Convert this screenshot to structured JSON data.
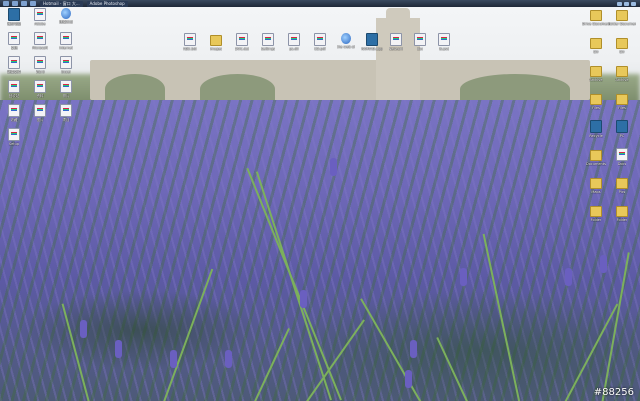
{
  "taskbar": {
    "tasks": [
      {
        "label": "Hotmail - 窗口 大..."
      },
      {
        "label": "Adobe Photoshop"
      }
    ]
  },
  "desktop": {
    "icons_left": [
      {
        "label": "我的电脑",
        "kind": "app"
      },
      {
        "label": "Adobe",
        "kind": "file"
      },
      {
        "label": "快捷方式",
        "kind": "web"
      },
      {
        "label": "文档",
        "kind": "file"
      },
      {
        "label": "Microsoft",
        "kind": "file"
      },
      {
        "label": "Internet",
        "kind": "file"
      },
      {
        "label": "新建文件",
        "kind": "file"
      },
      {
        "label": "Word",
        "kind": "file"
      },
      {
        "label": "Excel",
        "kind": "file"
      },
      {
        "label": "回收站",
        "kind": "file"
      },
      {
        "label": "资料",
        "kind": "file"
      },
      {
        "label": "照片",
        "kind": "file"
      },
      {
        "label": "收藏",
        "kind": "file"
      },
      {
        "label": "图片",
        "kind": "file"
      },
      {
        "label": "项目",
        "kind": "file"
      },
      {
        "label": "Setup",
        "kind": "file"
      }
    ],
    "icons_top": [
      {
        "label": "ADE.bdr",
        "kind": "file"
      },
      {
        "label": "Images",
        "kind": "folder"
      },
      {
        "label": "DOC.dat",
        "kind": "file"
      },
      {
        "label": "Settings",
        "kind": "file"
      },
      {
        "label": "ps.dll",
        "kind": "file"
      },
      {
        "label": "CD.pdf",
        "kind": "file"
      },
      {
        "label": "the web of",
        "kind": "web"
      },
      {
        "label": "NOMAD.app",
        "kind": "app"
      },
      {
        "label": "Network",
        "kind": "file"
      },
      {
        "label": "doc",
        "kind": "file"
      },
      {
        "label": "IS.psd",
        "kind": "file"
      }
    ],
    "icons_right": [
      {
        "label": "Drive Documents",
        "kind": "folder"
      },
      {
        "label": "Folder Documents",
        "kind": "folder"
      },
      {
        "label": "Dir",
        "kind": "folder"
      },
      {
        "label": "Dir",
        "kind": "folder"
      },
      {
        "label": "Archive",
        "kind": "folder"
      },
      {
        "label": "Archive",
        "kind": "folder"
      },
      {
        "label": "Files",
        "kind": "folder"
      },
      {
        "label": "Files",
        "kind": "folder"
      },
      {
        "label": "Recycle",
        "kind": "app"
      },
      {
        "label": "PC",
        "kind": "app"
      },
      {
        "label": "Documents",
        "kind": "folder"
      },
      {
        "label": "Docs",
        "kind": "file"
      },
      {
        "label": "Maps",
        "kind": "folder"
      },
      {
        "label": "Pics",
        "kind": "folder"
      },
      {
        "label": "Folder",
        "kind": "folder"
      },
      {
        "label": "Folder",
        "kind": "folder"
      }
    ]
  },
  "watermark": "#88256"
}
